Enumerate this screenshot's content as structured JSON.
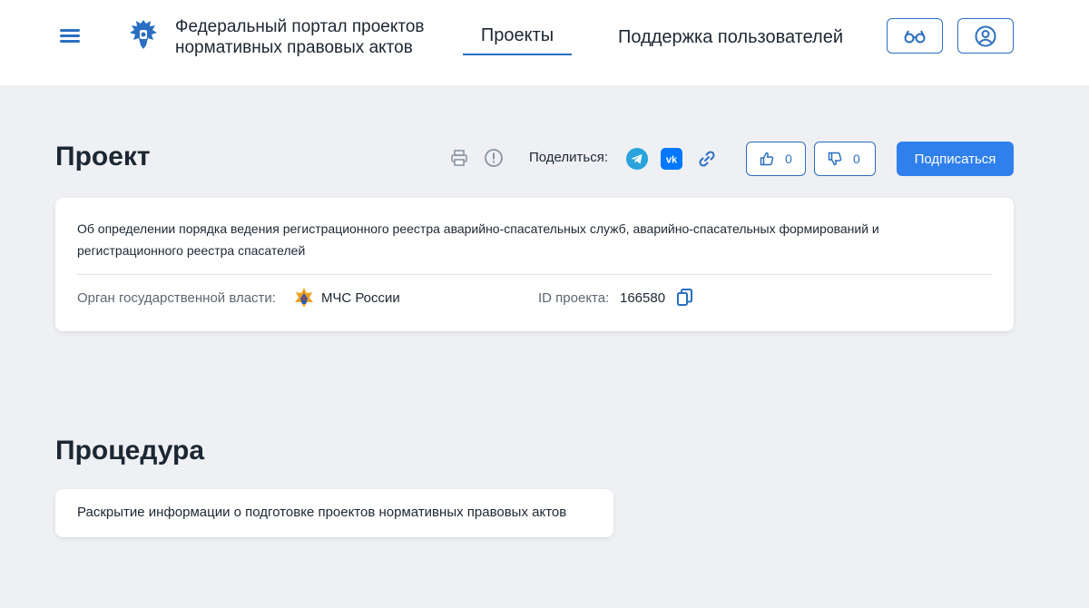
{
  "header": {
    "title": "Федеральный портал проектов нормативных правовых актов",
    "nav": {
      "projects": "Проекты",
      "support": "Поддержка пользователей"
    },
    "icons": {
      "menu": "burger-menu-icon",
      "emblem": "coat-of-arms-icon",
      "accessibility": "glasses-icon",
      "profile": "user-icon"
    }
  },
  "project": {
    "heading": "Проект",
    "share_label": "Поделиться:",
    "likes": "0",
    "dislikes": "0",
    "subscribe_label": "Подписаться",
    "title": "Об определении порядка ведения регистрационного реестра аварийно-спасательных служб, аварийно-спасательных формирований и регистрационного реестра спасателей",
    "authority_label": "Орган государственной власти:",
    "authority_value": "МЧС России",
    "id_label": "ID проекта:",
    "id_value": "166580"
  },
  "procedure": {
    "heading": "Процедура",
    "text": "Раскрытие информации о подготовке проектов нормативных правовых актов"
  },
  "colors": {
    "accent": "#2f80ed",
    "link": "#2a6fc1",
    "background": "#eef0f3",
    "telegram": "#2aa3dd",
    "vk": "#0077ff"
  }
}
